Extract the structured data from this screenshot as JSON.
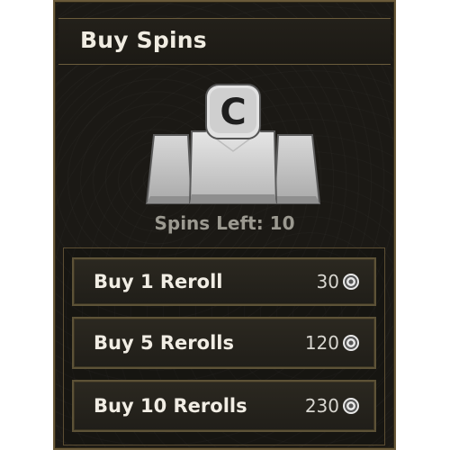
{
  "header": {
    "title": "Buy Spins"
  },
  "icon": {
    "name": "reroll-pieces-icon",
    "letter": "C"
  },
  "spins": {
    "label": "Spins Left: 10"
  },
  "buy_options": [
    {
      "label": "Buy 1 Reroll",
      "price": "30"
    },
    {
      "label": "Buy 5 Rerolls",
      "price": "120"
    },
    {
      "label": "Buy 10 Rerolls",
      "price": "230"
    }
  ],
  "colors": {
    "panel_bg": "#1b1915",
    "border_gold": "#6a5a3a",
    "text_light": "#f0ece2",
    "text_muted": "#9b9990"
  }
}
